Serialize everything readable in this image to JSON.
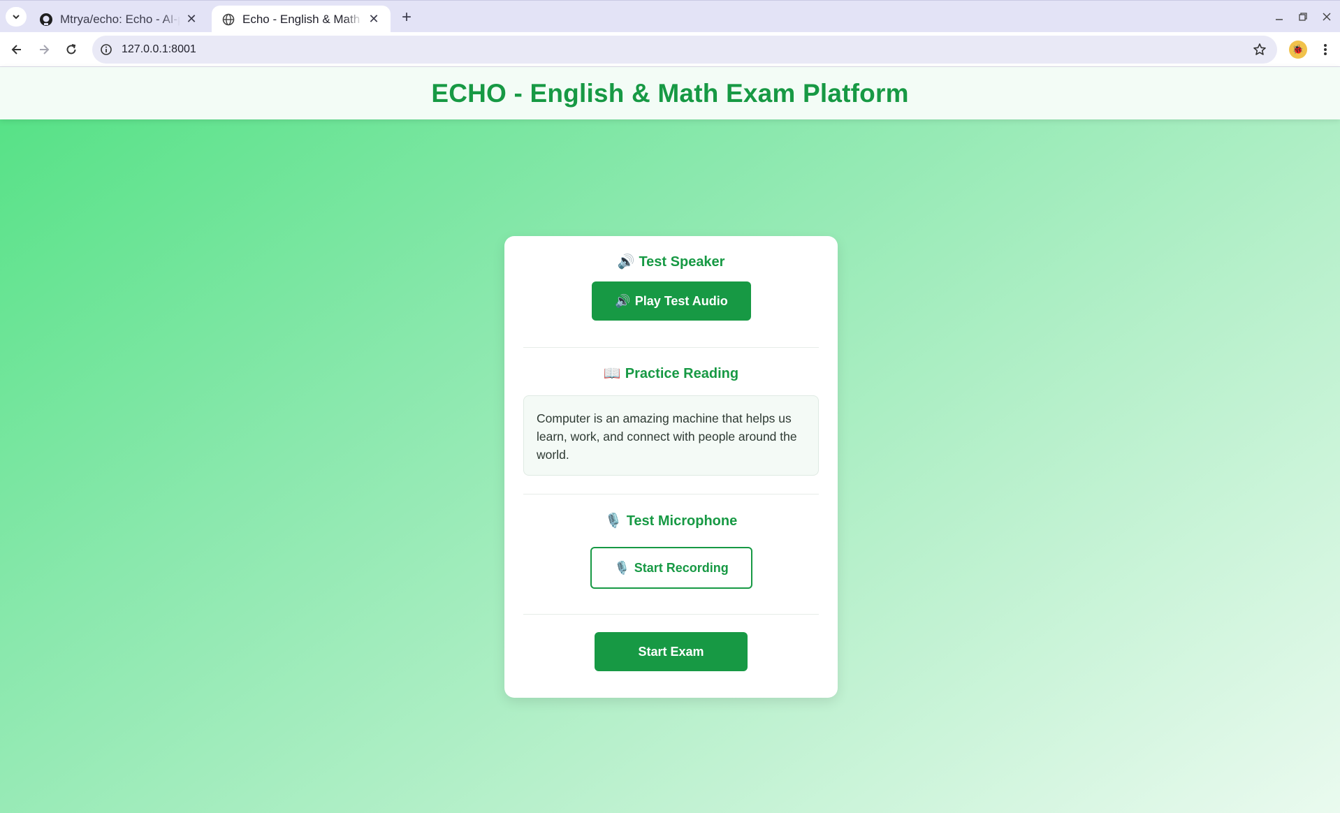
{
  "browser": {
    "tabs": [
      {
        "title": "Mtrya/echo: Echo - AI-powered",
        "favicon": "github-icon",
        "active": false
      },
      {
        "title": "Echo - English & Math Exam Platform",
        "favicon": "globe-icon",
        "active": true
      }
    ],
    "address": {
      "url": "127.0.0.1:8001"
    }
  },
  "page": {
    "title": "ECHO - English & Math Exam Platform",
    "colors": {
      "accent": "#179944",
      "background_start": "#52e183",
      "background_end": "#eafaef"
    }
  },
  "speaker": {
    "emoji": "🔊",
    "title": "Test Speaker",
    "button_emoji": "🔊",
    "button_label": "Play Test Audio"
  },
  "reading": {
    "emoji": "📖",
    "title": "Practice Reading",
    "text": "Computer is an amazing machine that helps us learn, work, and connect with people around the world."
  },
  "microphone": {
    "emoji": "🎙️",
    "title": "Test Microphone",
    "button_emoji": "🎙️",
    "button_label": "Start Recording"
  },
  "exam": {
    "button_label": "Start Exam"
  }
}
